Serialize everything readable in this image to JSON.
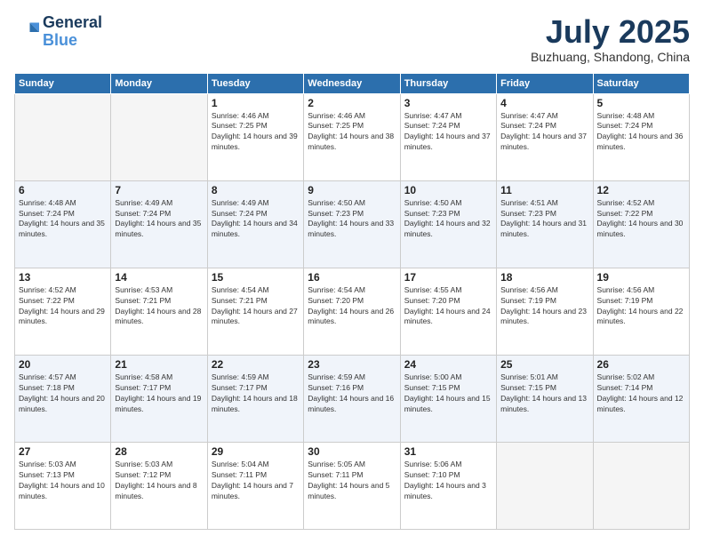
{
  "logo": {
    "line1": "General",
    "line2": "Blue"
  },
  "title": "July 2025",
  "location": "Buzhuang, Shandong, China",
  "weekdays": [
    "Sunday",
    "Monday",
    "Tuesday",
    "Wednesday",
    "Thursday",
    "Friday",
    "Saturday"
  ],
  "weeks": [
    [
      {
        "day": null
      },
      {
        "day": null
      },
      {
        "day": "1",
        "sunrise": "4:46 AM",
        "sunset": "7:25 PM",
        "daylight": "14 hours and 39 minutes."
      },
      {
        "day": "2",
        "sunrise": "4:46 AM",
        "sunset": "7:25 PM",
        "daylight": "14 hours and 38 minutes."
      },
      {
        "day": "3",
        "sunrise": "4:47 AM",
        "sunset": "7:24 PM",
        "daylight": "14 hours and 37 minutes."
      },
      {
        "day": "4",
        "sunrise": "4:47 AM",
        "sunset": "7:24 PM",
        "daylight": "14 hours and 37 minutes."
      },
      {
        "day": "5",
        "sunrise": "4:48 AM",
        "sunset": "7:24 PM",
        "daylight": "14 hours and 36 minutes."
      }
    ],
    [
      {
        "day": "6",
        "sunrise": "4:48 AM",
        "sunset": "7:24 PM",
        "daylight": "14 hours and 35 minutes."
      },
      {
        "day": "7",
        "sunrise": "4:49 AM",
        "sunset": "7:24 PM",
        "daylight": "14 hours and 35 minutes."
      },
      {
        "day": "8",
        "sunrise": "4:49 AM",
        "sunset": "7:24 PM",
        "daylight": "14 hours and 34 minutes."
      },
      {
        "day": "9",
        "sunrise": "4:50 AM",
        "sunset": "7:23 PM",
        "daylight": "14 hours and 33 minutes."
      },
      {
        "day": "10",
        "sunrise": "4:50 AM",
        "sunset": "7:23 PM",
        "daylight": "14 hours and 32 minutes."
      },
      {
        "day": "11",
        "sunrise": "4:51 AM",
        "sunset": "7:23 PM",
        "daylight": "14 hours and 31 minutes."
      },
      {
        "day": "12",
        "sunrise": "4:52 AM",
        "sunset": "7:22 PM",
        "daylight": "14 hours and 30 minutes."
      }
    ],
    [
      {
        "day": "13",
        "sunrise": "4:52 AM",
        "sunset": "7:22 PM",
        "daylight": "14 hours and 29 minutes."
      },
      {
        "day": "14",
        "sunrise": "4:53 AM",
        "sunset": "7:21 PM",
        "daylight": "14 hours and 28 minutes."
      },
      {
        "day": "15",
        "sunrise": "4:54 AM",
        "sunset": "7:21 PM",
        "daylight": "14 hours and 27 minutes."
      },
      {
        "day": "16",
        "sunrise": "4:54 AM",
        "sunset": "7:20 PM",
        "daylight": "14 hours and 26 minutes."
      },
      {
        "day": "17",
        "sunrise": "4:55 AM",
        "sunset": "7:20 PM",
        "daylight": "14 hours and 24 minutes."
      },
      {
        "day": "18",
        "sunrise": "4:56 AM",
        "sunset": "7:19 PM",
        "daylight": "14 hours and 23 minutes."
      },
      {
        "day": "19",
        "sunrise": "4:56 AM",
        "sunset": "7:19 PM",
        "daylight": "14 hours and 22 minutes."
      }
    ],
    [
      {
        "day": "20",
        "sunrise": "4:57 AM",
        "sunset": "7:18 PM",
        "daylight": "14 hours and 20 minutes."
      },
      {
        "day": "21",
        "sunrise": "4:58 AM",
        "sunset": "7:17 PM",
        "daylight": "14 hours and 19 minutes."
      },
      {
        "day": "22",
        "sunrise": "4:59 AM",
        "sunset": "7:17 PM",
        "daylight": "14 hours and 18 minutes."
      },
      {
        "day": "23",
        "sunrise": "4:59 AM",
        "sunset": "7:16 PM",
        "daylight": "14 hours and 16 minutes."
      },
      {
        "day": "24",
        "sunrise": "5:00 AM",
        "sunset": "7:15 PM",
        "daylight": "14 hours and 15 minutes."
      },
      {
        "day": "25",
        "sunrise": "5:01 AM",
        "sunset": "7:15 PM",
        "daylight": "14 hours and 13 minutes."
      },
      {
        "day": "26",
        "sunrise": "5:02 AM",
        "sunset": "7:14 PM",
        "daylight": "14 hours and 12 minutes."
      }
    ],
    [
      {
        "day": "27",
        "sunrise": "5:03 AM",
        "sunset": "7:13 PM",
        "daylight": "14 hours and 10 minutes."
      },
      {
        "day": "28",
        "sunrise": "5:03 AM",
        "sunset": "7:12 PM",
        "daylight": "14 hours and 8 minutes."
      },
      {
        "day": "29",
        "sunrise": "5:04 AM",
        "sunset": "7:11 PM",
        "daylight": "14 hours and 7 minutes."
      },
      {
        "day": "30",
        "sunrise": "5:05 AM",
        "sunset": "7:11 PM",
        "daylight": "14 hours and 5 minutes."
      },
      {
        "day": "31",
        "sunrise": "5:06 AM",
        "sunset": "7:10 PM",
        "daylight": "14 hours and 3 minutes."
      },
      {
        "day": null
      },
      {
        "day": null
      }
    ]
  ]
}
